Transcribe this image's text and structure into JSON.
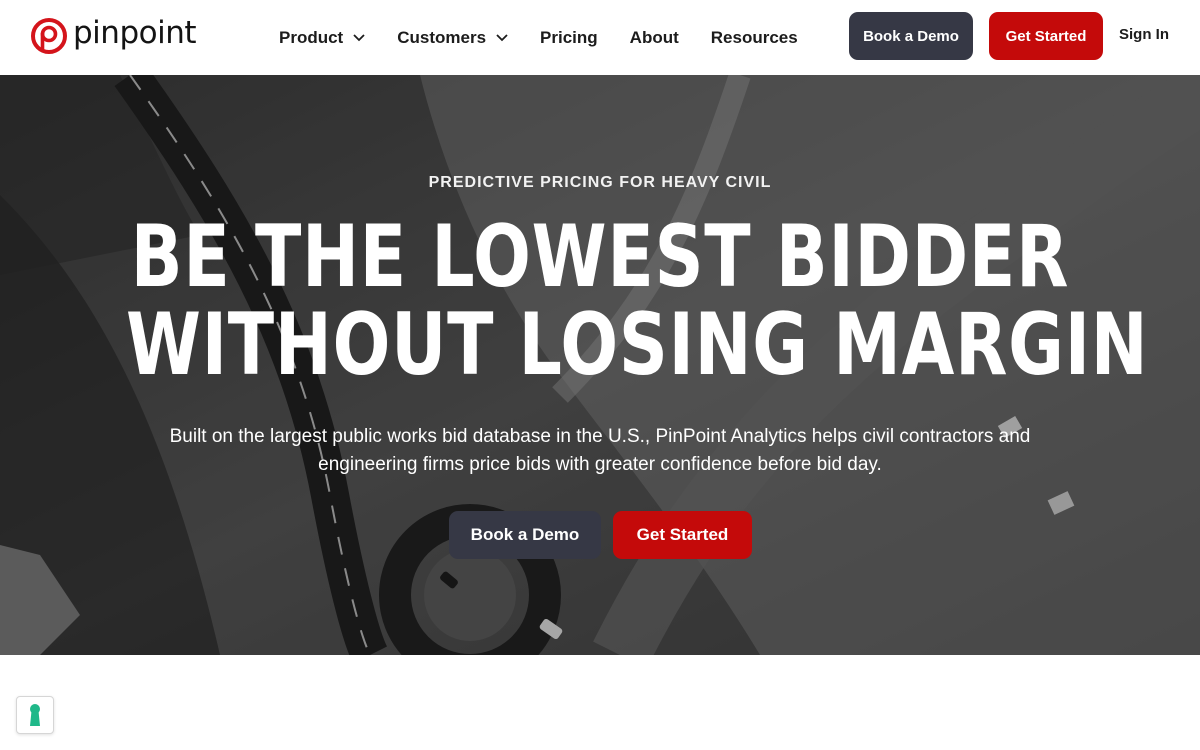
{
  "brand": {
    "name": "pinpoint",
    "accent_color": "#c40a0a",
    "dark_button_color": "#363845",
    "logo_icon": "pinpoint-p-logo-icon"
  },
  "nav": {
    "items": [
      {
        "label": "Product",
        "has_dropdown": true,
        "icon": "chevron-down-icon"
      },
      {
        "label": "Customers",
        "has_dropdown": true,
        "icon": "chevron-down-icon"
      },
      {
        "label": "Pricing",
        "has_dropdown": false
      },
      {
        "label": "About",
        "has_dropdown": false
      },
      {
        "label": "Resources",
        "has_dropdown": false
      }
    ],
    "demo_button": "Book a Demo",
    "start_button": "Get Started",
    "signin_link": "Sign In"
  },
  "hero": {
    "eyebrow": "PREDICTIVE PRICING FOR HEAVY CIVIL",
    "headline_line1": "BE THE LOWEST BIDDER",
    "headline_line2": "WITHOUT LOSING MARGIN",
    "subtext": "Built on the largest public works bid database in the U.S., PinPoint Analytics helps civil contractors and engineering firms price bids with greater confidence before bid day.",
    "demo_button": "Book a Demo",
    "start_button": "Get Started",
    "background": "aerial-construction-photo"
  },
  "cookie_settings": {
    "icon": "keyhole-icon",
    "icon_color": "#1fb889"
  }
}
